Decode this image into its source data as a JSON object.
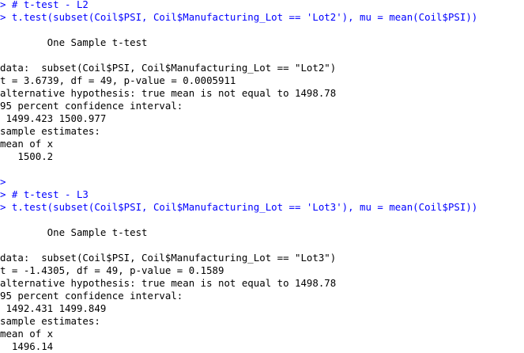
{
  "console": {
    "lines": [
      {
        "kind": "cmd",
        "text": "> # t-test - L2"
      },
      {
        "kind": "cmd",
        "text": "> t.test(subset(Coil$PSI, Coil$Manufacturing_Lot == 'Lot2'), mu = mean(Coil$PSI))"
      },
      {
        "kind": "out",
        "text": ""
      },
      {
        "kind": "out",
        "text": "        One Sample t-test"
      },
      {
        "kind": "out",
        "text": ""
      },
      {
        "kind": "out",
        "text": "data:  subset(Coil$PSI, Coil$Manufacturing_Lot == \"Lot2\")"
      },
      {
        "kind": "out",
        "text": "t = 3.6739, df = 49, p-value = 0.0005911"
      },
      {
        "kind": "out",
        "text": "alternative hypothesis: true mean is not equal to 1498.78"
      },
      {
        "kind": "out",
        "text": "95 percent confidence interval:"
      },
      {
        "kind": "out",
        "text": " 1499.423 1500.977"
      },
      {
        "kind": "out",
        "text": "sample estimates:"
      },
      {
        "kind": "out",
        "text": "mean of x "
      },
      {
        "kind": "out",
        "text": "   1500.2 "
      },
      {
        "kind": "out",
        "text": ""
      },
      {
        "kind": "cmd",
        "text": "> "
      },
      {
        "kind": "cmd",
        "text": "> # t-test - L3"
      },
      {
        "kind": "cmd",
        "text": "> t.test(subset(Coil$PSI, Coil$Manufacturing_Lot == 'Lot3'), mu = mean(Coil$PSI))"
      },
      {
        "kind": "out",
        "text": ""
      },
      {
        "kind": "out",
        "text": "        One Sample t-test"
      },
      {
        "kind": "out",
        "text": ""
      },
      {
        "kind": "out",
        "text": "data:  subset(Coil$PSI, Coil$Manufacturing_Lot == \"Lot3\")"
      },
      {
        "kind": "out",
        "text": "t = -1.4305, df = 49, p-value = 0.1589"
      },
      {
        "kind": "out",
        "text": "alternative hypothesis: true mean is not equal to 1498.78"
      },
      {
        "kind": "out",
        "text": "95 percent confidence interval:"
      },
      {
        "kind": "out",
        "text": " 1492.431 1499.849"
      },
      {
        "kind": "out",
        "text": "sample estimates:"
      },
      {
        "kind": "out",
        "text": "mean of x "
      },
      {
        "kind": "out",
        "text": "  1496.14 "
      }
    ],
    "colors": {
      "command": "#0000ff",
      "output": "#000000",
      "background": "#ffffff"
    }
  }
}
